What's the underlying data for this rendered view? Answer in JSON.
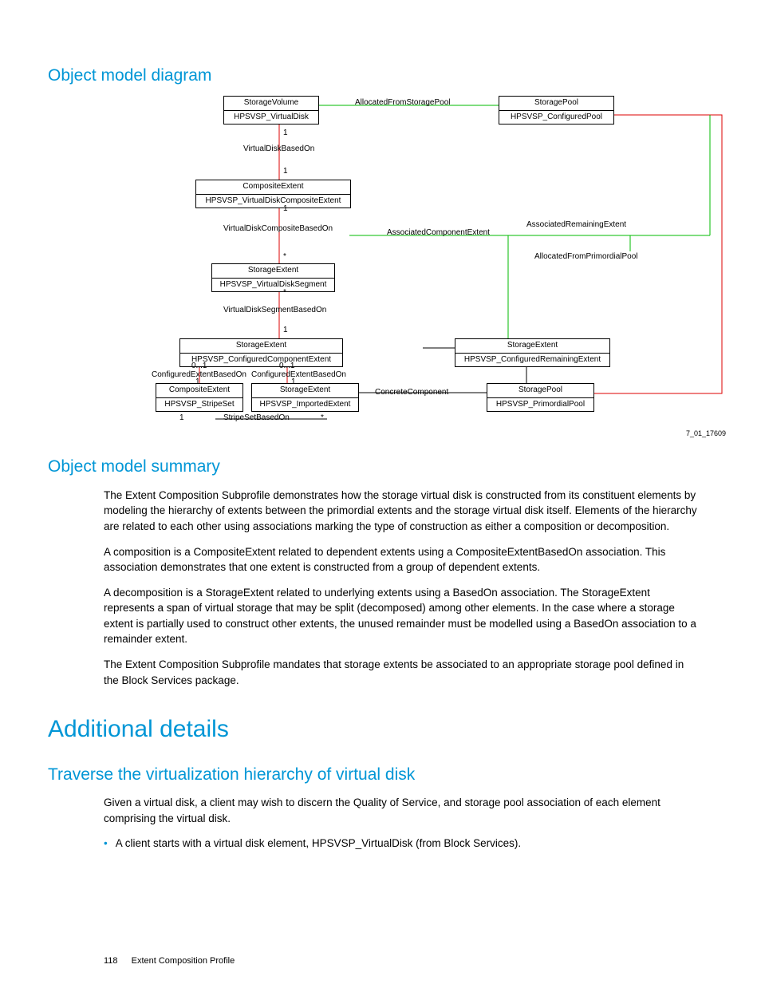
{
  "headings": {
    "h_objmodeldiagram": "Object model diagram",
    "h_objmodelsummary": "Object model summary",
    "h_additionaldetails": "Additional details",
    "h_traverse": "Traverse the virtualization hierarchy of virtual disk"
  },
  "diagram": {
    "fig_no": "7_01_17609",
    "entities": {
      "e1_t": "StorageVolume",
      "e1_b": "HPSVSP_VirtualDisk",
      "e2_t": "StoragePool",
      "e2_b": "HPSVSP_ConfiguredPool",
      "e3_t": "CompositeExtent",
      "e3_b": "HPSVSP_VirtualDiskCompositeExtent",
      "e4_t": "StorageExtent",
      "e4_b": "HPSVSP_VirtualDiskSegment",
      "e5_t": "StorageExtent",
      "e5_b": "HPSVSP_ConfiguredComponentExtent",
      "e6_t": "StorageExtent",
      "e6_b": "HPSVSP_ConfiguredRemainingExtent",
      "e7_t": "CompositeExtent",
      "e7_b": "HPSVSP_StripeSet",
      "e8_t": "StorageExtent",
      "e8_b": "HPSVSP_ImportedExtent",
      "e9_t": "StoragePool",
      "e9_b": "HPSVSP_PrimordialPool"
    },
    "labels": {
      "allocFromSP": "AllocatedFromStoragePool",
      "vdBasedOn": "VirtualDiskBasedOn",
      "vdCompBasedOn": "VirtualDiskCompositeBasedOn",
      "assocComp": "AssociatedComponentExtent",
      "assocRemain": "AssociatedRemainingExtent",
      "allocPrim": "AllocatedFromPrimordialPool",
      "vdSegBasedOn": "VirtualDiskSegmentBasedOn",
      "confExtBasedOn1": "ConfiguredExtentBasedOn",
      "confExtBasedOn2": "ConfiguredExtentBasedOn",
      "concreteComp": "ConcreteComponent",
      "stripeSetBasedOn": "StripeSetBasedOn",
      "one_a": "1",
      "one_b": "1",
      "one_c": "1",
      "one_d": "1",
      "one_e": "1",
      "one_f": "1",
      "one_g": "1",
      "star_a": "*",
      "star_b": "*",
      "star_c": "*",
      "zo_a": "0...1",
      "zo_b": "0...1"
    }
  },
  "paragraphs": {
    "p1": "The Extent Composition Subprofile demonstrates how the storage virtual disk is constructed from its constituent elements by modeling the hierarchy of extents between the primordial extents and the storage virtual disk itself. Elements of the hierarchy are related to each other using associations marking the type of construction as either a composition or decomposition.",
    "p2": "A composition is a CompositeExtent related to dependent extents using a CompositeExtentBasedOn association. This association demonstrates that one extent is constructed from a group of dependent extents.",
    "p3": "A decomposition is a StorageExtent related to underlying extents using a BasedOn association. The StorageExtent represents a span of virtual storage that may be split (decomposed) among other elements. In the case where a storage extent is partially used to construct other extents, the unused remainder must be modelled using a BasedOn association to a remainder extent.",
    "p4": "The Extent Composition Subprofile mandates that storage extents be associated to an appropriate storage pool defined in the Block Services package.",
    "p5": "Given a virtual disk, a client may wish to discern the Quality of Service, and storage pool association of each element comprising the virtual disk.",
    "b1": "A client starts with a virtual disk element, HPSVSP_VirtualDisk (from Block Services)."
  },
  "footer": {
    "page_no": "118",
    "section": "Extent Composition Profile"
  }
}
